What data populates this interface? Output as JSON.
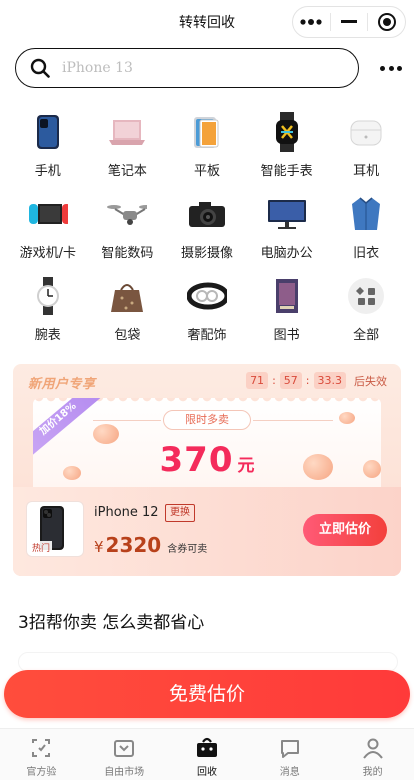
{
  "navbar": {
    "title": "转转回收"
  },
  "search": {
    "placeholder": "iPhone 13"
  },
  "categories": [
    {
      "label": "手机",
      "icon": "phone-icon"
    },
    {
      "label": "笔记本",
      "icon": "laptop-icon"
    },
    {
      "label": "平板",
      "icon": "tablet-icon"
    },
    {
      "label": "智能手表",
      "icon": "smartwatch-icon"
    },
    {
      "label": "耳机",
      "icon": "earbuds-icon"
    },
    {
      "label": "游戏机/卡",
      "icon": "game-console-icon"
    },
    {
      "label": "智能数码",
      "icon": "drone-icon"
    },
    {
      "label": "摄影摄像",
      "icon": "camera-icon"
    },
    {
      "label": "电脑办公",
      "icon": "monitor-icon"
    },
    {
      "label": "旧衣",
      "icon": "shirt-icon"
    },
    {
      "label": "腕表",
      "icon": "wristwatch-icon"
    },
    {
      "label": "包袋",
      "icon": "handbag-icon"
    },
    {
      "label": "奢配饰",
      "icon": "belt-icon"
    },
    {
      "label": "图书",
      "icon": "book-icon"
    },
    {
      "label": "全部",
      "icon": "all-categories-icon"
    }
  ],
  "promo": {
    "title": "新用户专享",
    "countdown": {
      "h": "71",
      "m": "57",
      "s": "33.3",
      "suffix": "后失效"
    },
    "ribbon": "加价18%",
    "limit_tag": "限时多卖",
    "amount": "370",
    "amount_unit": "元",
    "product": {
      "name": "iPhone 12",
      "swap_label": "更换",
      "hot_tag": "热门",
      "price_symbol": "¥",
      "price": "2320",
      "price_note": "含券可卖"
    },
    "estimate_button": "立即估价"
  },
  "section_title": "3招帮你卖 怎么卖都省心",
  "main_button": "免费估价",
  "tabs": [
    {
      "label": "官方验",
      "icon": "verify-icon"
    },
    {
      "label": "自由市场",
      "icon": "market-icon"
    },
    {
      "label": "回收",
      "icon": "recycle-bag-icon",
      "active": true
    },
    {
      "label": "消息",
      "icon": "message-icon"
    },
    {
      "label": "我的",
      "icon": "profile-icon"
    }
  ],
  "colors": {
    "accent": "#ff4d3c",
    "promo_bg": "#fde3d8",
    "amount": "#f42b5b"
  }
}
